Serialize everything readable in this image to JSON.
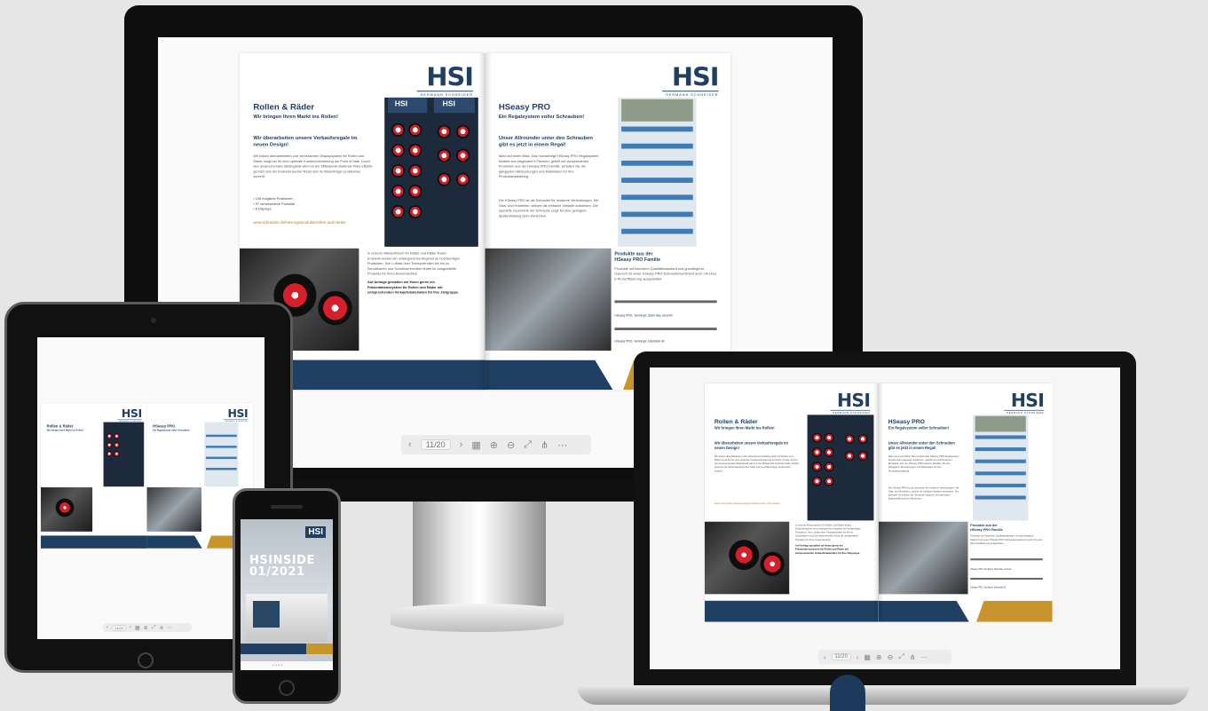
{
  "brand": {
    "logo": "HSI",
    "logo_subtitle": "HERMANN SCHNEIDER"
  },
  "left_page": {
    "title": "Rollen & Räder",
    "subtitle": "Wir bringen Ihren Markt ins Rollen!",
    "heading": "Wir überarbeiten unsere Verkaufsregale im neuen Design!",
    "body": "Wir haben überarbeiteten und verbesserten Displaysystem für Rollen und Räder sorgt bei Ihr eine optimale Kundenorientierung am Point of Sale. Durch den ansprechenden Befüngstall wird nur der Mittelpunkt stellende Platz effektiv genutzt und der Endverbraucher findet sich im Warenträger problemlos zurecht.",
    "bullets": [
      "• 106 mögliche Positionen",
      "• 97 verschiedene Produkte",
      "• 6 Displays"
    ],
    "link": "www.schneider.de/loesungsprodukte/rollen-und-raeder",
    "photo_text": "In unserer Mietsortiment für Räder und Räder finden Endverbraucher ein umfangreiches Angebot an hochwertigen Produkten. Von Luftrad über Transportrollen bis hin zu Schubkarren und Schubkarrenrollen findet Ihr ausgewählte Produkte für Ihren Anwendertrick.",
    "photo_text_bold": "Auf Anfrage gestalten wir Ihnen gerne ein Präsentationssystem für Rollen und Räder mit entsprechenden Verkaufsmaterialien für Ihre Zielgruppe."
  },
  "right_page": {
    "title": "HSeasy PRO",
    "subtitle": "Ein Regalsystem voller Schrauben!",
    "heading": "Unser Allrounder unter den Schrauben gibt es jetzt in einem Regal!",
    "body": "Allen auf einen Blick: Das hochwertige HSeasy PRO Regalsystem besteht aus insgesamt 6 Fächern, gefüllt mit verschiedenen Produkten aus der HSeasy PRO Familie. Erhalten Sie die gängigsten Abmessungen und Materialien für Ihre Produktausstattung.",
    "body2": "Die HSeasy PRO ist die Schraube für moderne Verbindungen. Mit Glas- und Holzteilen, welche die einfache Variante aufweisen. Die spezielle Geometrie der Schraube sorgt für eine geringere Spaltenbildung beim Eindrehen.",
    "products_title": "Produkte aus der\nHSeasy PRO Familie",
    "products_body": "Produkte mit höchstem Qualitätsstandard und grundlegend. Dadurch ist unser HSeasy PRO-Schraubensortiment auch mit einer ETA-Zertifizierung ausgestattet.",
    "screw_labels": [
      "HSeasy PRO, Senkkopf, Stahl blau verzinkt",
      "HSeasy PRO, Senkkopf, Edelstahl A2"
    ]
  },
  "toolbar": {
    "page_indicator": "11/20",
    "icons": [
      "chevron-left-icon",
      "chevron-right-icon",
      "grid-icon",
      "zoom-in-icon",
      "zoom-out-icon",
      "fullscreen-icon",
      "share-icon",
      "more-icon"
    ]
  },
  "cover": {
    "title_line1": "HSINSIDE",
    "title_line2": "01/2021"
  },
  "colors": {
    "navy": "#1f3f63",
    "gold": "#c7952b",
    "red": "#d5202b"
  }
}
